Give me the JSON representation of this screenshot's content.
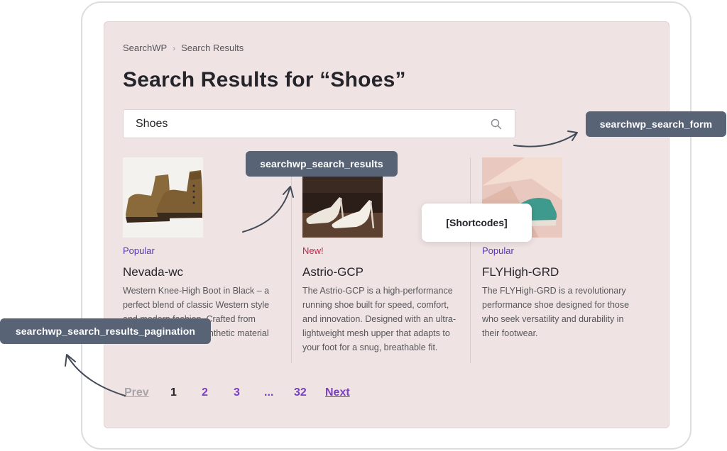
{
  "breadcrumb": {
    "home": "SearchWP",
    "separator": "›",
    "current": "Search Results"
  },
  "page_title": "Search Results for “Shoes”",
  "search": {
    "value": "Shoes",
    "icon": "search-icon"
  },
  "results": [
    {
      "badge": "Popular",
      "badge_color": "#5a33b8",
      "title": "Nevada-wc",
      "description": "Western Knee-High Boot in Black – a perfect blend of classic Western style and modern fashion. Crafted from premium leather or synthetic material",
      "image": "brown-ankle-boots"
    },
    {
      "badge": "New!",
      "badge_color": "#c0264a",
      "title": "Astrio-GCP",
      "description": "The Astrio-GCP is a high-performance running shoe built for speed, comfort, and innovation. Designed with an ultra-lightweight mesh upper that adapts to your foot for a snug, breathable fit.",
      "image": "white-high-heels"
    },
    {
      "badge": "Popular",
      "badge_color": "#5a33b8",
      "title": "FLYHigh-GRD",
      "description": "The FLYHigh-GRD is a revolutionary performance shoe designed for those who seek versatility and durability in their footwear.",
      "image": "teal-sneaker"
    }
  ],
  "pagination": {
    "prev": "Prev",
    "pages": [
      "1",
      "2",
      "3",
      "...",
      "32"
    ],
    "current": "1",
    "next": "Next",
    "link_color": "#7b3fc4",
    "disabled_color": "#a8a4a8"
  },
  "callouts": {
    "search_form": "searchwp_search_form",
    "search_results": "searchwp_search_results",
    "pagination": "searchwp_search_results_pagination",
    "shortcodes": "[Shortcodes]"
  },
  "colors": {
    "page_bg": "#efe4e3",
    "tag_bg": "#586376",
    "title": "#24242a"
  }
}
